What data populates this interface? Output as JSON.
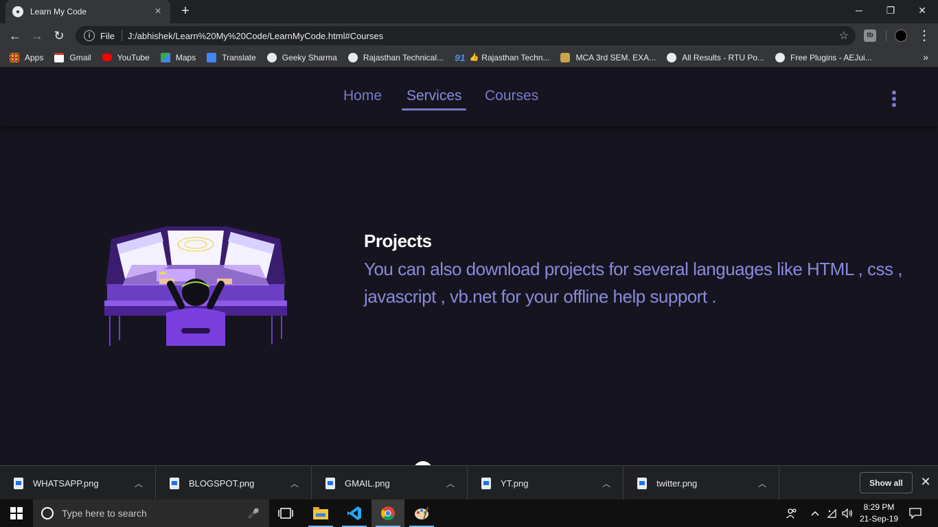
{
  "browser": {
    "tab_title": "Learn My Code",
    "new_tab_symbol": "+",
    "window_controls": {
      "minimize": "─",
      "restore": "❐",
      "close": "✕"
    },
    "nav": {
      "back": "←",
      "forward": "→",
      "reload": "↻"
    },
    "url_scheme": "File",
    "url": "J:/abhishek/Learn%20My%20Code/LearnMyCode.html#Courses",
    "info_symbol": "i",
    "star_symbol": "☆",
    "extension_label": "tb",
    "menu_symbol": "⋮"
  },
  "bookmarks": [
    {
      "label": "Apps",
      "icon": "apps-grid-icon",
      "color": "#ea4335"
    },
    {
      "label": "Gmail",
      "icon": "gmail-icon",
      "color": "#d93025"
    },
    {
      "label": "YouTube",
      "icon": "youtube-icon",
      "color": "#ff0000"
    },
    {
      "label": "Maps",
      "icon": "maps-icon",
      "color": "#34a853"
    },
    {
      "label": "Translate",
      "icon": "translate-icon",
      "color": "#4285f4"
    },
    {
      "label": "Geeky Sharma",
      "icon": "globe-icon",
      "color": "#e8eaed"
    },
    {
      "label": "Rajasthan Technical...",
      "icon": "globe-icon",
      "color": "#e8eaed"
    },
    {
      "label": "Rajasthan Techn...",
      "icon": "ninety-one-icon",
      "color": "#4a8fe8",
      "prefix": "91",
      "emoji": "👍"
    },
    {
      "label": "MCA 3rd SEM. EXA...",
      "icon": "crest-icon",
      "color": "#c9a24a"
    },
    {
      "label": "All Results - RTU Po...",
      "icon": "globe-icon",
      "color": "#e8eaed"
    },
    {
      "label": "Free Plugins - AEJui...",
      "icon": "globe-icon",
      "color": "#e8eaed"
    }
  ],
  "bookmarks_more": "»",
  "site": {
    "nav": {
      "home": "Home",
      "services": "Services",
      "courses": "Courses"
    },
    "section_title": "Projects",
    "section_text": "You can also download projects for several languages like HTML , css , javascript , vb.net for your offline help support ."
  },
  "downloads": [
    {
      "name": "WHATSAPP.png",
      "chevron": "︿"
    },
    {
      "name": "BLOGSPOT.png",
      "chevron": "︿"
    },
    {
      "name": "GMAIL.png",
      "chevron": "︿"
    },
    {
      "name": "YT.png",
      "chevron": "︿"
    },
    {
      "name": "twitter.png",
      "chevron": "︿"
    }
  ],
  "show_all": "Show all",
  "shelf_close": "✕",
  "taskbar": {
    "search_placeholder": "Type here to search",
    "mic_symbol": "🎤",
    "time": "8:29 PM",
    "date": "21-Sep-19"
  },
  "colors": {
    "accent": "#7a79c9",
    "page_bg": "#16151f",
    "text_accent": "#8a89dc"
  }
}
